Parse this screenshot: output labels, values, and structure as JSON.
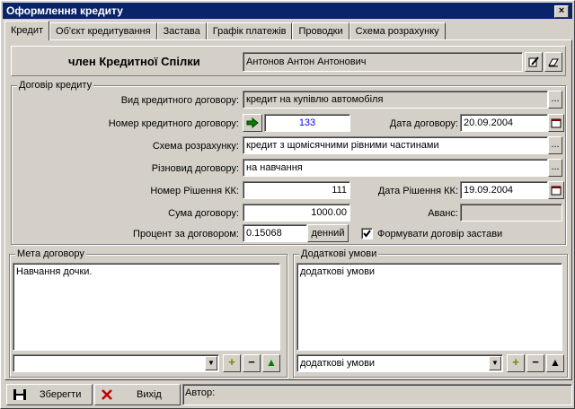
{
  "window": {
    "title": "Оформлення кредиту",
    "close": "×"
  },
  "tabs": [
    "Кредит",
    "Об'єкт кредитування",
    "Застава",
    "Графік платежів",
    "Проводки",
    "Схема розрахунку"
  ],
  "member": {
    "label": "член Кредитної Спілки",
    "value": "Антонов Антон Антонович"
  },
  "contract": {
    "group_title": "Договір кредиту",
    "type_label": "Вид кредитного договору:",
    "type_value": "кредит на купівлю автомобіля",
    "number_label": "Номер кредитного договору:",
    "number_value": "133",
    "date_label": "Дата договору:",
    "date_value": "20.09.2004",
    "scheme_label": "Схема розрахунку:",
    "scheme_value": "кредит з щомісячними рівними частинами",
    "kind_label": "Різновид договору:",
    "kind_value": "на навчання",
    "decision_no_label": "Номер Рішення КК:",
    "decision_no_value": "111",
    "decision_date_label": "Дата Рішення КК:",
    "decision_date_value": "19.09.2004",
    "sum_label": "Сума договору:",
    "sum_value": "1000.00",
    "advance_label": "Аванс:",
    "advance_value": "",
    "rate_label": "Процент за договором:",
    "rate_value": "0.15068",
    "rate_button": "денний",
    "pledge_checkbox": "Формувати договір застави",
    "ellipsis": "..."
  },
  "purpose": {
    "title": "Мета договору",
    "text": "Навчання дочки.",
    "combo_value": ""
  },
  "extra": {
    "title": "Додаткові умови",
    "text": "додаткові умови",
    "combo_value": "додаткові умови"
  },
  "footer": {
    "save": "Зберегти",
    "exit": "Вихід",
    "author_label": "Автор:"
  },
  "colors": {
    "title_bg": "#0a246a",
    "number_text": "#0000ff",
    "arrow": "#008000"
  }
}
